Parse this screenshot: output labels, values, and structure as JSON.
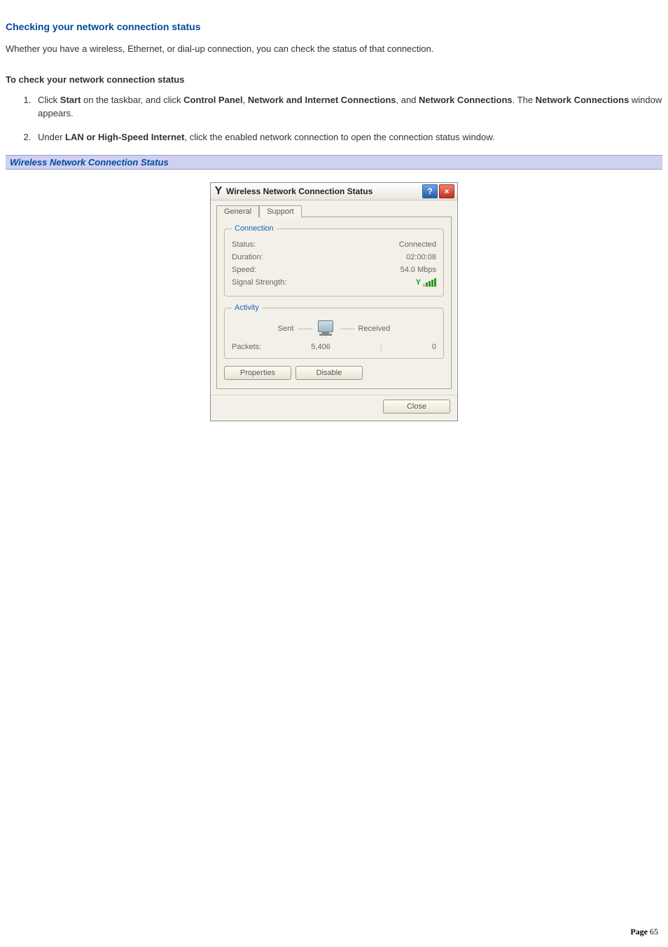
{
  "heading": "Checking your network connection status",
  "intro": "Whether you have a wireless, Ethernet, or dial-up connection, you can check the status of that connection.",
  "subheading": "To check your network connection status",
  "step1": {
    "pre": "Click ",
    "b1": "Start",
    "mid1": " on the taskbar, and click ",
    "b2": "Control Panel",
    "sep": ", ",
    "b3": "Network and Internet Connections",
    "mid2": ", and ",
    "b4": "Network Connections",
    "mid3": ". The ",
    "b5": "Network Connections",
    "post": " window appears."
  },
  "step2": {
    "pre": "Under ",
    "b1": "LAN or High-Speed Internet",
    "post": ", click the enabled network connection to open the connection status window."
  },
  "caption": "Wireless Network Connection Status",
  "dialog": {
    "title": "Wireless Network Connection Status",
    "help": "?",
    "close": "×",
    "tabs": {
      "general": "General",
      "support": "Support"
    },
    "groups": {
      "connection": "Connection",
      "activity": "Activity"
    },
    "labels": {
      "status": "Status:",
      "duration": "Duration:",
      "speed": "Speed:",
      "signal": "Signal Strength:",
      "sent": "Sent",
      "received": "Received",
      "packets": "Packets:"
    },
    "values": {
      "status": "Connected",
      "duration": "02:00:08",
      "speed": "54.0 Mbps",
      "packets_sent": "5,406",
      "packets_received": "0"
    },
    "buttons": {
      "properties": "Properties",
      "disable": "Disable",
      "close": "Close"
    }
  },
  "footer": {
    "label": "Page",
    "num": "65"
  }
}
